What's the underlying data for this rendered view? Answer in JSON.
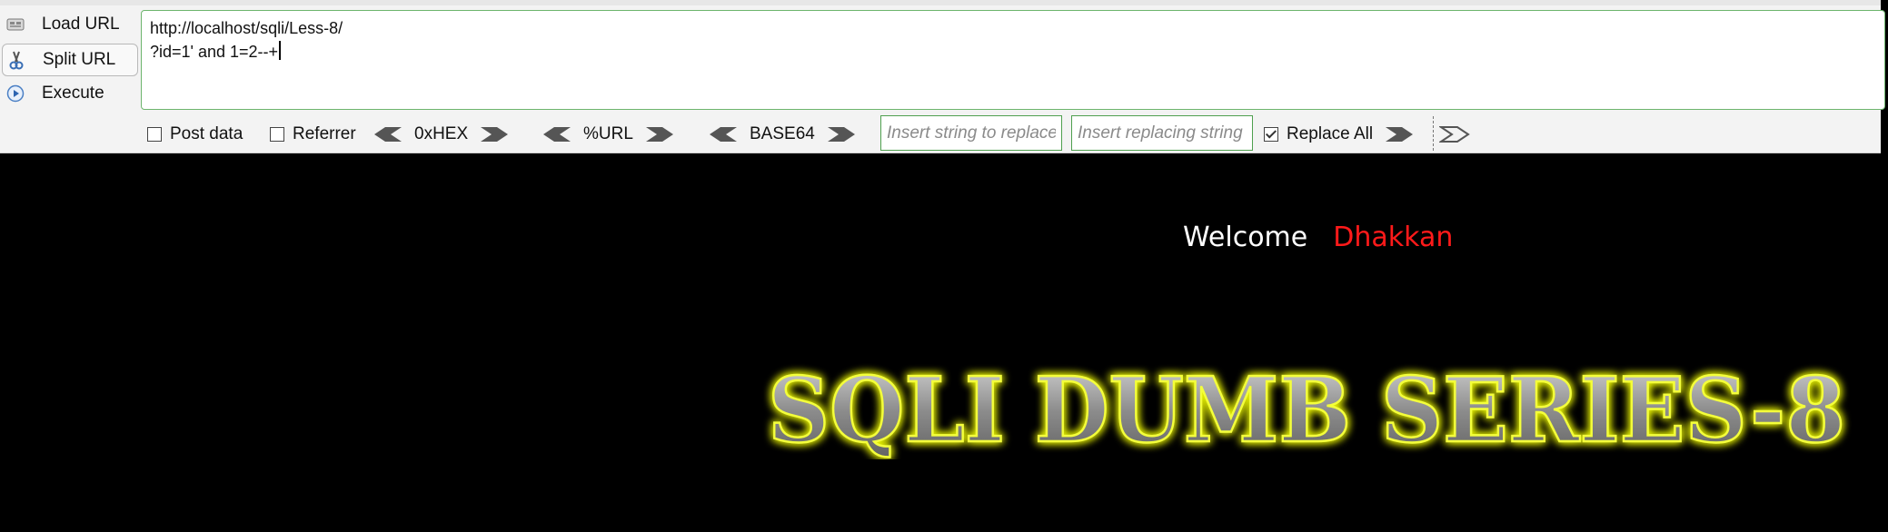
{
  "hackbar": {
    "actions": {
      "load": "Load URL",
      "split": "Split URL",
      "execute": "Execute"
    },
    "url_lines": [
      "http://localhost/sqli/Less-8/",
      "?id=1' and 1=2--+"
    ],
    "options": {
      "post_data": {
        "label": "Post data",
        "checked": false
      },
      "referrer": {
        "label": "Referrer",
        "checked": false
      },
      "replace_all": {
        "label": "Replace All",
        "checked": true
      }
    },
    "encoders": {
      "hex": "0xHEX",
      "url": "%URL",
      "base64": "BASE64"
    },
    "replace": {
      "find_placeholder": "Insert string to replace",
      "replace_placeholder": "Insert replacing string"
    }
  },
  "page": {
    "welcome": "Welcome",
    "user": "Dhakkan",
    "banner": "SQLI DUMB SERIES-8"
  },
  "colors": {
    "accent_green": "#4fa04f",
    "user_red": "#ff1a1a",
    "banner_glow": "#e6f000",
    "background": "#000000"
  }
}
